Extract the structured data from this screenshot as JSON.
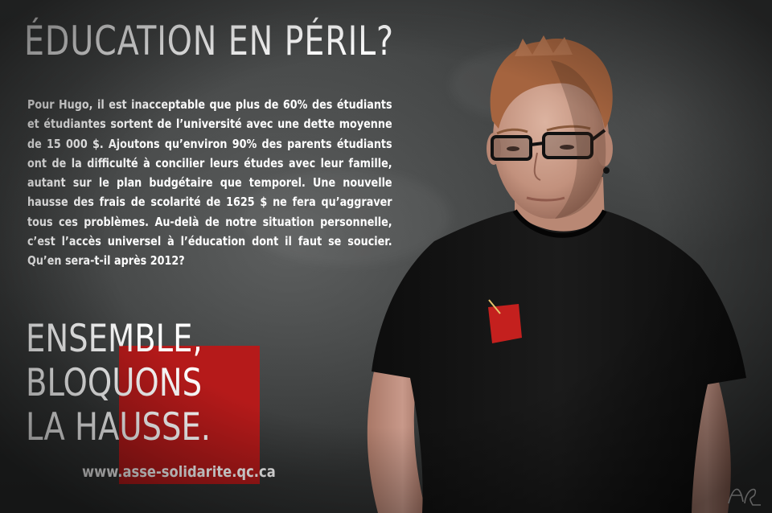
{
  "poster": {
    "title": "ÉDUCATION EN PÉRIL?",
    "body": "Pour Hugo, il est inacceptable que plus de 60% des étudiants et étudiantes sortent de l’université avec une dette moyenne de 15 000 $. Ajoutons qu’environ 90% des parents étudiants ont de la difficulté à concilier leurs études avec leur famille, autant sur le plan budgétaire que temporel. Une nouvelle hausse des frais de scolarité de 1625 $ ne fera qu’aggraver tous ces problèmes. Au-delà de notre situation personnelle, c’est l’accès universel à l’éducation dont il faut se soucier. Qu’en sera-t-il après 2012?",
    "slogan": [
      "ENSEMBLE,",
      "BLOQUONS",
      "LA HAUSSE."
    ],
    "url": "www.asse-solidarite.qc.ca",
    "signature": "AR"
  },
  "colors": {
    "background": "#3d3f3f",
    "accent_red": "#b51a1a",
    "text": "#ffffff",
    "shirt": "#121212",
    "skin": "#c99a86",
    "hair": "#b0704a"
  }
}
